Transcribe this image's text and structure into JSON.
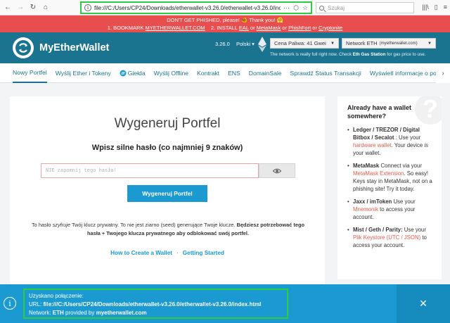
{
  "browser": {
    "url": "file:///C:/Users/CP24/Downloads/etherwallet-v3.26.0/etherwallet-v3.26.0/inc",
    "search_placeholder": "Szukaj"
  },
  "banner": {
    "line1": "DON'T GET PHISHED, please! 🐠 Thank you! 🤗",
    "line2_prefix": "1. BOOKMARK ",
    "line2_link1": "MYETHERWALLET.COM",
    "line2_mid": "    2. INSTALL ",
    "line2_link2": "EAL",
    "line2_or1": " or ",
    "line2_link3": "MetaMask",
    "line2_or2": " or ",
    "line2_link4": "PhishFort",
    "line2_or3": " or ",
    "line2_link5": "Cryptonite"
  },
  "header": {
    "brand": "MyEtherWallet",
    "version": "3.26.0",
    "language": "Polski",
    "gas_price": "Cena Paliwa: 41 Gwei",
    "network": "Network ETH",
    "network_provider": "(myetherwallet.com)",
    "gas_note_prefix": "The network is really full right now. Check ",
    "gas_note_link": "Eth Gas Station",
    "gas_note_suffix": " for gas price to use."
  },
  "nav": {
    "items": [
      {
        "label": "Nowy Portfel"
      },
      {
        "label": "Wyślij Ether i Tokeny"
      },
      {
        "label": "Giełda"
      },
      {
        "label": "Wyślij Offline"
      },
      {
        "label": "Kontrakt"
      },
      {
        "label": "ENS"
      },
      {
        "label": "DomainSale"
      },
      {
        "label": "Sprawdź Status Transakcji"
      },
      {
        "label": "Wyświetl informacje o portfe"
      }
    ]
  },
  "main": {
    "title": "Wygeneruj Portfel",
    "subtitle": "Wpisz silne hasło (co najmniej 9 znaków)",
    "password_placeholder": "NIE zapomnij tego hasła!",
    "generate_button": "Wygeneruj Portfel",
    "note_part1": "To hasło ",
    "note_italic": "szyfruje",
    "note_part2": " Twój klucz prywatny. To nie jest ziarno (seed) generujące Twoje klucze. ",
    "note_bold": "Będziesz potrzebować tego hasła + Twojego klucza prywatnego aby odblokować swój portfel.",
    "link_create": "How to Create a Wallet",
    "link_sep": "·",
    "link_start": "Getting Started"
  },
  "sidebar": {
    "title": "Already have a wallet somewhere?",
    "items": [
      {
        "bold": "Ledger / TREZOR / Digital Bitbox / Secalot",
        "t1": " : Use your ",
        "hl": "hardware wallet",
        "t2": ". Your device ",
        "em": "is",
        "t3": " your wallet."
      },
      {
        "bold": "MetaMask",
        "t1": " Connect via your ",
        "hl": "MetaMask Extension",
        "t2": ". So easy! Keys stay in MetaMask, not on a phishing site! Try it today.",
        "em": "",
        "t3": ""
      },
      {
        "bold": "Jaxx / imToken",
        "t1": " Use your ",
        "hl": "Mnemonik",
        "t2": " to access your account.",
        "em": "",
        "t3": ""
      },
      {
        "bold": "Mist / Geth / Parity:",
        "t1": " Use your ",
        "hl": "Plik Keystore (UTC / JSON)",
        "t2": " to access your account.",
        "em": "",
        "t3": ""
      }
    ]
  },
  "notice": {
    "line1": "Uzyskano połączenie:",
    "line2_label": "URL: ",
    "line2_value": "file:///C:/Users/CP24/Downloads/etherwallet-v3.26.0/etherwallet-v3.26.0/index.html",
    "line3_label": "Network: ",
    "line3_network": "ETH",
    "line3_mid": " provided by ",
    "line3_provider": "myetherwallet.com"
  },
  "colors": {
    "header_bg": "#1a738f",
    "banner_bg": "#e94e4e",
    "accent_blue": "#1a9ad0",
    "highlight_red": "#e85a4f",
    "frame_green": "#2ecc40"
  }
}
